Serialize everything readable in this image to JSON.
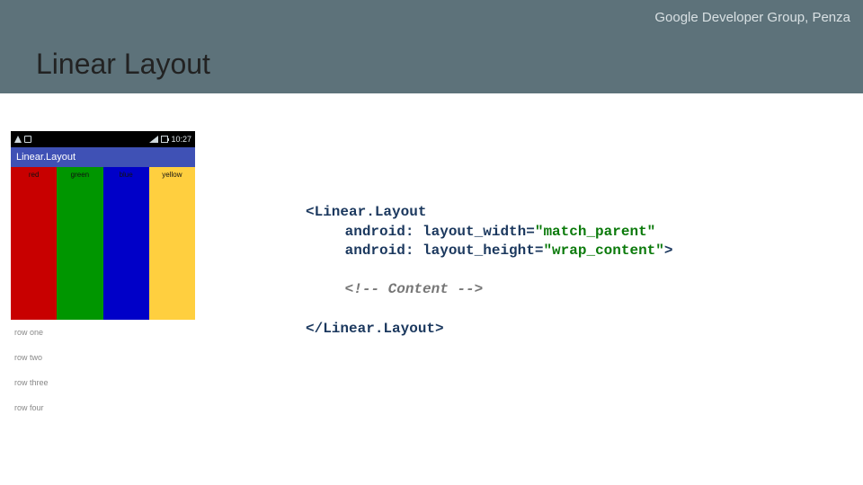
{
  "header": {
    "brand": "Google Developer Group, Penza"
  },
  "title": "Linear Layout",
  "phone": {
    "time": "10:27",
    "app_title": "Linear.Layout",
    "colors": [
      {
        "label": "red",
        "class": "c-red"
      },
      {
        "label": "green",
        "class": "c-green"
      },
      {
        "label": "blue",
        "class": "c-blue"
      },
      {
        "label": "yellow",
        "class": "c-yellow"
      }
    ],
    "rows": [
      "row one",
      "row two",
      "row three",
      "row four"
    ]
  },
  "code": {
    "open_tag": "<Linear.Layout",
    "attr1_name": "android: layout_width=",
    "attr1_val": "\"match_parent\"",
    "attr2_name": "android: layout_height=",
    "attr2_val": "\"wrap_content\"",
    "close_angle": ">",
    "comment": "<!-- Content -->",
    "end_tag": "</Linear.Layout>"
  }
}
